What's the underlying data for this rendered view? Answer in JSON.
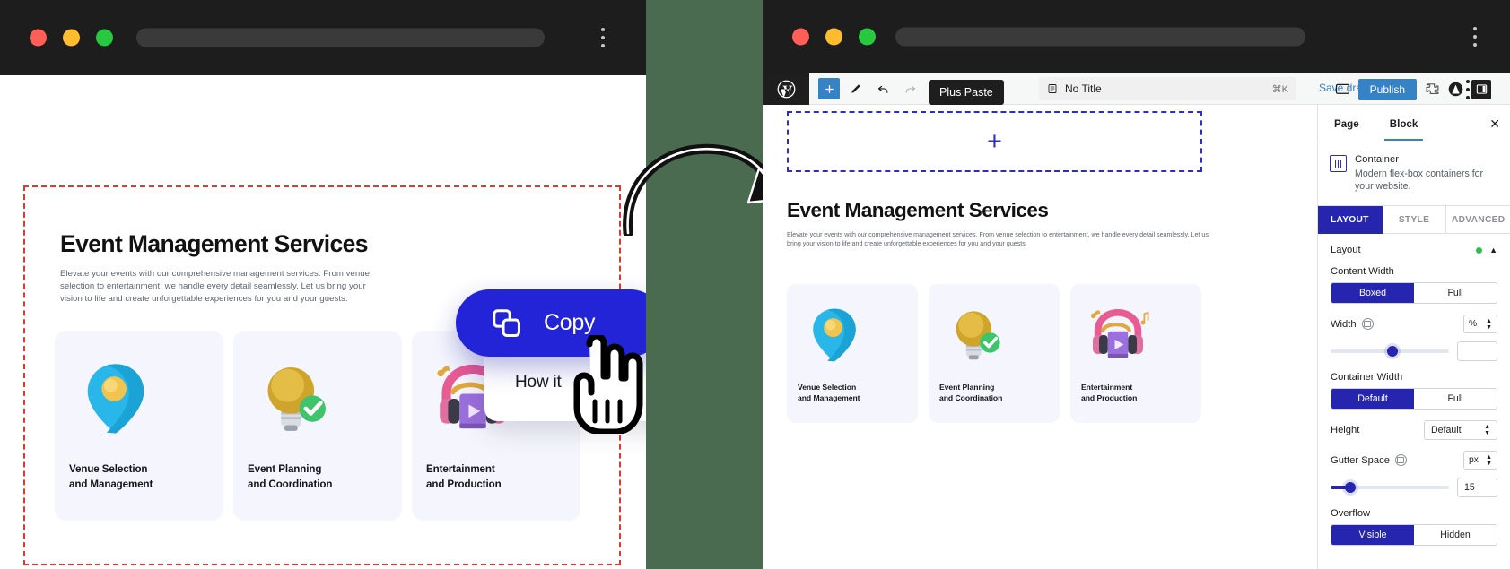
{
  "stage": {
    "background_green": "#4a6b4f"
  },
  "left_window": {
    "chrome": {
      "dots": [
        "close",
        "minimize",
        "maximize"
      ],
      "url_value": "",
      "menu": "kebab-menu"
    },
    "page": {
      "title": "Event Management Services",
      "subtitle": "Elevate your events with our comprehensive management services. From venue selection to entertainment, we handle every detail seamlessly. Let us bring your vision to life and create unforgettable experiences for you and your guests.",
      "cards": [
        {
          "icon": "location-pin-icon",
          "caption_line1": "Venue Selection",
          "caption_line2": "and Management"
        },
        {
          "icon": "lightbulb-check-icon",
          "caption_line1": "Event Planning",
          "caption_line2": "and Coordination"
        },
        {
          "icon": "headphones-music-icon",
          "caption_line1": "Entertainment",
          "caption_line2": "and Production"
        }
      ],
      "selection_outline_color": "#e8362e"
    },
    "popup": {
      "copy_label": "Copy",
      "copy_icon": "copy-icon",
      "copy_bg": "#2323d8",
      "how_it_label": "How it"
    }
  },
  "right_window": {
    "chrome": {
      "dots": [
        "close",
        "minimize",
        "maximize"
      ],
      "url_value": "",
      "menu": "kebab-menu"
    },
    "toolbar": {
      "logo": "wordpress-logo-icon",
      "buttons": [
        {
          "name": "add-block-button",
          "icon": "plus-icon"
        },
        {
          "name": "edit-tool-button",
          "icon": "pencil-icon"
        },
        {
          "name": "undo-button",
          "icon": "undo-arrow-icon"
        },
        {
          "name": "redo-button",
          "icon": "redo-arrow-icon"
        },
        {
          "name": "list-view-button",
          "icon": "list-view-icon"
        },
        {
          "name": "plus-paste-button",
          "icon": "clipboard-paste-icon"
        }
      ],
      "tooltip": "Plus Paste",
      "document_title": "No Title",
      "document_icon": "document-icon",
      "shortcut": "⌘K",
      "save_draft": "Save draft",
      "preview_icon": "preview-monitor-icon",
      "publish_label": "Publish",
      "plugin_icon": "plugin-puzzle-icon",
      "astra_icon": "astra-logo-icon",
      "settings_icon": "settings-sidebar-icon",
      "options_icon": "options-kebab-icon",
      "publish_bg": "#3582c4"
    },
    "canvas": {
      "drop_zone": {
        "label": "",
        "plus_icon": "plus-icon",
        "border_color": "#2c2cc9"
      },
      "title": "Event Management Services",
      "subtitle": "Elevate your events with our comprehensive management services. From venue selection to entertainment, we handle every detail seamlessly. Let us bring your vision to life and create unforgettable experiences for you and your guests.",
      "cards": [
        {
          "icon": "location-pin-icon",
          "caption_line1": "Venue Selection",
          "caption_line2": "and Management"
        },
        {
          "icon": "lightbulb-check-icon",
          "caption_line1": "Event Planning",
          "caption_line2": "and Coordination"
        },
        {
          "icon": "headphones-music-icon",
          "caption_line1": "Entertainment",
          "caption_line2": "and Production"
        }
      ]
    },
    "sidebar": {
      "tabs": [
        {
          "label": "Page",
          "active": false
        },
        {
          "label": "Block",
          "active": true
        }
      ],
      "close_icon": "close-icon",
      "block": {
        "icon": "container-block-icon",
        "name": "Container",
        "description": "Modern flex-box containers for your website."
      },
      "section_tabs": [
        {
          "label": "LAYOUT",
          "active": true
        },
        {
          "label": "STYLE",
          "active": false
        },
        {
          "label": "ADVANCED",
          "active": false
        }
      ],
      "controls": {
        "layout_label": "Layout",
        "layout_status_color": "#2bbf4e",
        "layout_chevron": "chevron-up-icon",
        "content_width_label": "Content Width",
        "content_width_options": [
          "Boxed",
          "Full"
        ],
        "content_width_value": "Boxed",
        "width_label": "Width",
        "width_device_icon": "desktop-icon",
        "width_unit": "%",
        "width_value": "",
        "width_slider_percent": 52,
        "container_width_label": "Container Width",
        "container_width_options": [
          "Default",
          "Full"
        ],
        "container_width_value": "Default",
        "height_label": "Height",
        "height_value": "Default",
        "gutter_label": "Gutter Space",
        "gutter_device_icon": "desktop-icon",
        "gutter_unit": "px",
        "gutter_value": "15",
        "gutter_slider_percent": 17,
        "overflow_label": "Overflow",
        "overflow_options": [
          "Visible",
          "Hidden"
        ],
        "overflow_value": "Visible"
      }
    }
  },
  "annotations": {
    "arrow": "curved-arrow-icon",
    "hand_cursor": "hand-pointer-cursor"
  }
}
